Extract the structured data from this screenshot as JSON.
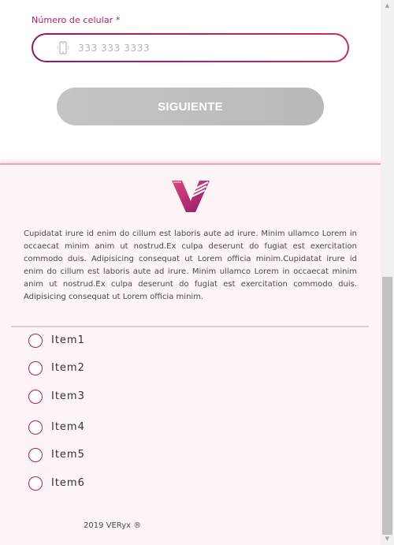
{
  "form": {
    "phone_label": "Número de celular *",
    "phone_placeholder": "333 333 3333",
    "phone_value": "",
    "next_button_label": "SIGUIENTE"
  },
  "footer": {
    "description": "Cupidatat irure id enim do cillum est laboris aute ad irure. Minim ullamco Lorem in occaecat minim anim ut nostrud.Ex culpa deserunt do fugiat est exercitation commodo duis. Adipisicing consequat ut Lorem officia minim.Cupidatat irure id enim do cillum est laboris aute ad irure. Minim ullamco Lorem in occaecat minim anim ut nostrud.Ex culpa deserunt do fugiat est exercitation commodo duis. Adipisicing consequat ut Lorem officia minim.",
    "items": [
      "Item1",
      "Item2",
      "Item3",
      "Item4",
      "Item5",
      "Item6"
    ],
    "copyright": "2019 VERyx ®"
  },
  "icons": {
    "phone_field": "mobile-phone-icon",
    "logo": "v-logo"
  },
  "colors": {
    "accent": "#c2185b",
    "accent_dark": "#8e1a6a",
    "button_disabled": "#c4c4c4",
    "footer_bg": "#fcf4f6"
  }
}
